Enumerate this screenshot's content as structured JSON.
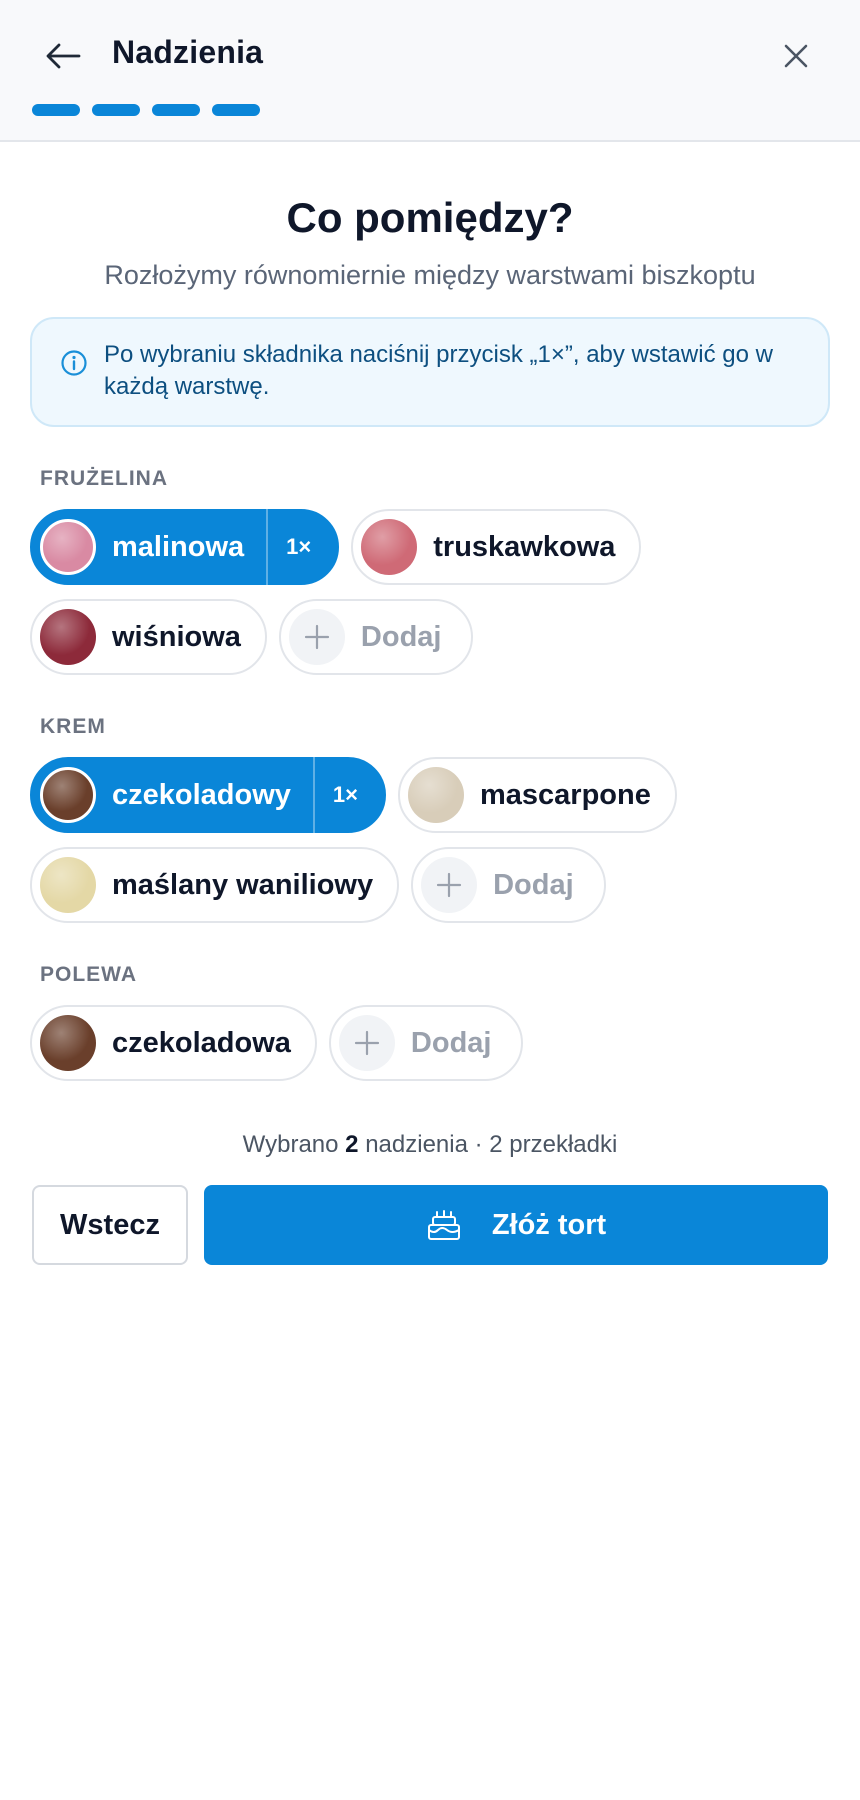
{
  "header": {
    "title": "Nadzienia",
    "progress_steps": 4,
    "progress_completed": 4
  },
  "main": {
    "headline": "Co pomiędzy?",
    "subhead": "Rozłożymy równomiernie między warstwami biszkoptu",
    "info": "Po wybraniu składnika naciśnij przycisk „1×”, aby wstawić go w każdą warstwę."
  },
  "sections": [
    {
      "label": "FRUŻELINA",
      "items": [
        {
          "label": "malinowa",
          "selected": true,
          "count": "1×",
          "color": "#d98aa3"
        },
        {
          "label": "truskawkowa",
          "selected": false,
          "color": "#cf6a76"
        },
        {
          "label": "wiśniowa",
          "selected": false,
          "color": "#8d2a3a"
        }
      ],
      "add_label": "Dodaj"
    },
    {
      "label": "KREM",
      "items": [
        {
          "label": "czekoladowy",
          "selected": true,
          "count": "1×",
          "color": "#6a3f2b"
        },
        {
          "label": "mascarpone",
          "selected": false,
          "color": "#d8cdb9"
        },
        {
          "label": "maślany waniliowy",
          "selected": false,
          "color": "#e4d8a6"
        }
      ],
      "add_label": "Dodaj"
    },
    {
      "label": "POLEWA",
      "items": [
        {
          "label": "czekoladowa",
          "selected": false,
          "color": "#6a3f2b"
        }
      ],
      "add_label": "Dodaj"
    }
  ],
  "summary": {
    "prefix": "Wybrano",
    "count": "2",
    "suffix": "nadzienia · 2 przekładki"
  },
  "actions": {
    "back_label": "Wstecz",
    "primary_label": "Złóż tort"
  },
  "icons": {
    "back": "arrow-left-icon",
    "close": "close-icon",
    "info": "info-icon",
    "add": "plus-icon",
    "primary": "cake-icon"
  },
  "colors": {
    "accent": "#0a86d8",
    "info_bg": "#eff8fe",
    "info_text": "#0d4f80"
  }
}
